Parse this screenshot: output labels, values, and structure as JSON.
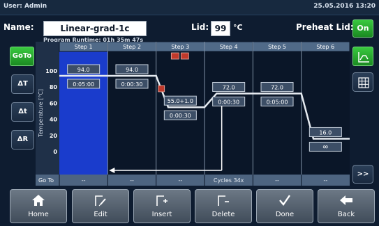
{
  "status": {
    "user": "User: Admin",
    "datetime": "25.05.2016 13:20"
  },
  "program": {
    "name_label": "Name:",
    "name": "Linear-grad-1c",
    "runtime": "Program Runtime:  01h 35m 47s",
    "lid_label": "Lid:",
    "lid_value": "99",
    "lid_unit": "°C",
    "preheat_label": "Preheat Lid:",
    "preheat_value": "On"
  },
  "left_buttons": {
    "goto": "GoTo",
    "delta_t": "ΔT",
    "delta_time": "Δt",
    "delta_r": "ΔR"
  },
  "right_buttons": {
    "graph": "graph-icon",
    "table": "table-icon",
    "next": ">>"
  },
  "chart_data": {
    "type": "line",
    "ylabel": "Temperature [°C]",
    "yticks": [
      "100",
      "80",
      "60",
      "40",
      "20",
      "0"
    ],
    "ylim": [
      0,
      110
    ],
    "steps": [
      {
        "label": "Step 1",
        "temp": "94.0",
        "time": "0:05:00",
        "temp_value": 94,
        "selected": true
      },
      {
        "label": "Step 2",
        "temp": "94.0",
        "time": "0:00:30",
        "temp_value": 94
      },
      {
        "label": "Step 3",
        "temp": "55.0",
        "gradient": "+1.0",
        "time": "0:00:30",
        "temp_value": 55
      },
      {
        "label": "Step 4",
        "temp": "72.0",
        "time": "0:00:30",
        "temp_value": 72
      },
      {
        "label": "Step 5",
        "temp": "72.0",
        "time": "0:05:00",
        "temp_value": 72
      },
      {
        "label": "Step 6",
        "temp": "16.0",
        "time": "∞",
        "temp_value": 16
      }
    ],
    "goto_label": "Go To",
    "goto_cells": [
      "--",
      "--",
      "--",
      "Cycles 34x",
      "--",
      "--"
    ],
    "goto_arrow": {
      "from_step": 4,
      "to_step": 1
    }
  },
  "nav": {
    "home": "Home",
    "edit": "Edit",
    "insert": "Insert",
    "delete": "Delete",
    "done": "Done",
    "back": "Back"
  }
}
